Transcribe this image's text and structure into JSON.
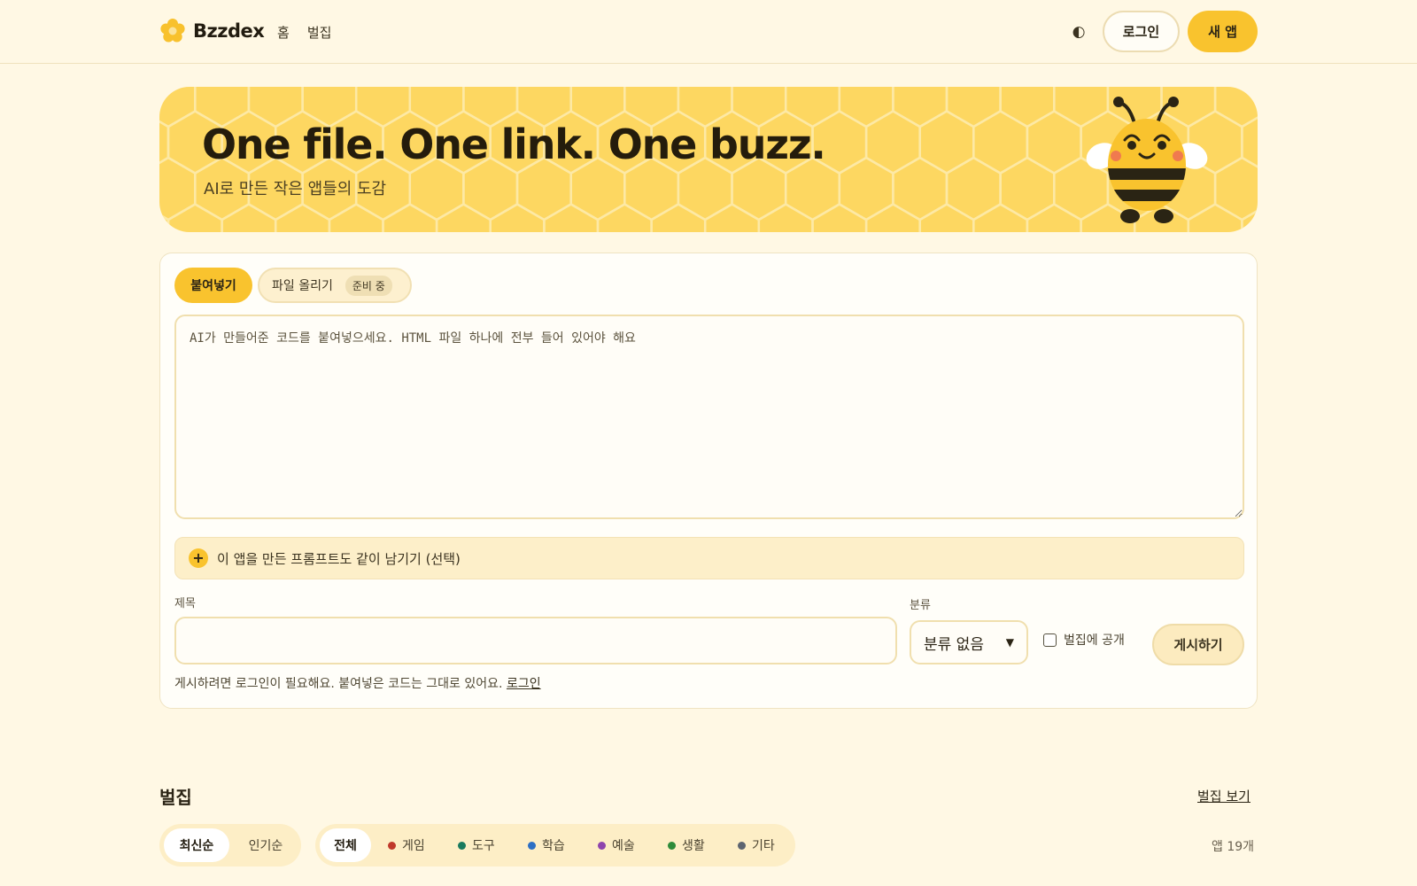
{
  "header": {
    "brand": "Bzzdex",
    "nav": [
      "홈",
      "벌집"
    ],
    "theme_toggle": "◐",
    "login_label": "로그인",
    "new_app_label": "새 앱"
  },
  "hero": {
    "title": "One file. One link. One buzz.",
    "subtitle": "AI로 만든 작은 앱들의 도감"
  },
  "composer": {
    "tabs": [
      {
        "label": "붙여넣기",
        "active": true
      },
      {
        "label": "파일 올리기",
        "badge": "준비 중",
        "active": false
      }
    ],
    "code_placeholder": "AI가 만들어준 코드를 붙여넣으세요. HTML 파일 하나에 전부 들어 있어야 해요",
    "prompt_toggle": "이 앱을 만든 프롬프트도 같이 남기기 (선택)",
    "title_label": "제목",
    "title_value": "",
    "category_label": "분류",
    "category_selected": "분류 없음",
    "public_label": "벌집에 공개",
    "public_checked": false,
    "post_label": "게시하기",
    "login_note": "게시하려면 로그인이 필요해요. 붙여넣은 코드는 그대로 있어요.",
    "login_link": "로그인"
  },
  "gallery": {
    "title": "벌집",
    "view_all": "벌집 보기",
    "sort": [
      {
        "label": "최신순",
        "active": true
      },
      {
        "label": "인기순",
        "active": false
      }
    ],
    "filters": [
      {
        "label": "전체",
        "color": "",
        "active": true
      },
      {
        "label": "게임",
        "color": "#c0392b"
      },
      {
        "label": "도구",
        "color": "#1a7a5e"
      },
      {
        "label": "학습",
        "color": "#2d6fc4"
      },
      {
        "label": "예술",
        "color": "#8e44ad"
      },
      {
        "label": "생활",
        "color": "#2e8b3a"
      },
      {
        "label": "기타",
        "color": "#5d6470"
      }
    ],
    "count": "앱 19개"
  },
  "colors": {
    "accent": "#f9c32e",
    "background": "#fff8e4",
    "hero": "#fdd761"
  }
}
